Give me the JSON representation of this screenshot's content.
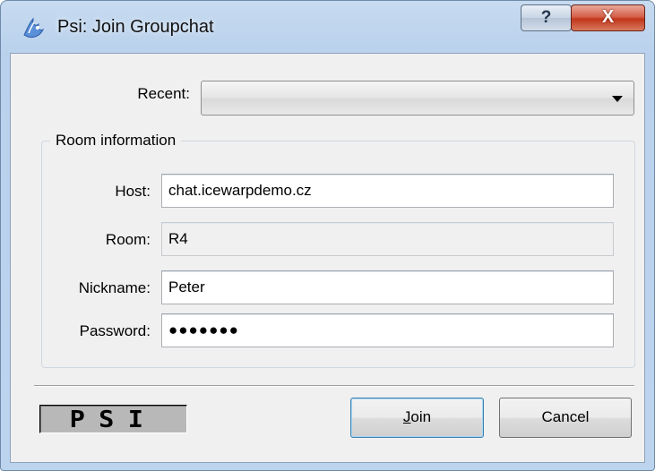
{
  "window": {
    "title": "Psi: Join Groupchat",
    "help_glyph": "?",
    "close_glyph": "X",
    "icon": "psi-app-icon"
  },
  "recent": {
    "label": "Recent:",
    "value": ""
  },
  "room_info": {
    "title": "Room information",
    "host_label": "Host:",
    "host_value": "chat.icewarpdemo.cz",
    "room_label": "Room:",
    "room_value": "R4",
    "nickname_label": "Nickname:",
    "nickname_value": "Peter",
    "password_label": "Password:",
    "password_value": "●●●●●●●"
  },
  "footer": {
    "logo_text": "PSI",
    "join_label_prefix": "J",
    "join_label_rest": "oin",
    "cancel_label": "Cancel"
  },
  "colors": {
    "title_gradient": "#bcd4ee",
    "client_bg": "#f0f0f0",
    "close_button": "#c0361b",
    "default_button_border": "#3c7fb1"
  }
}
